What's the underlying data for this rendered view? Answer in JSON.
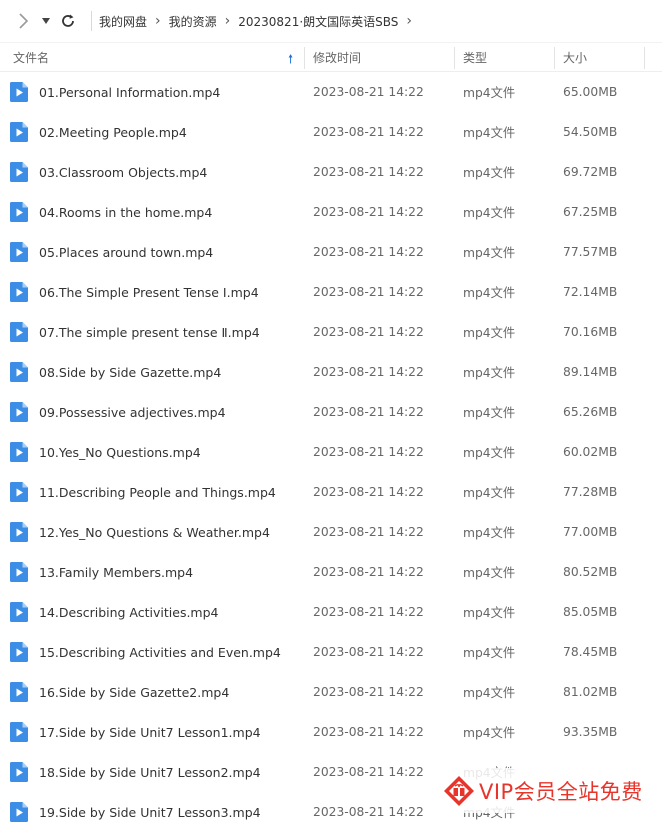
{
  "colors": {
    "accent": "#1e6fd9",
    "file_icon": "#3c8de6",
    "watermark": "#e8352b"
  },
  "toolbar": {
    "forward_icon": "chevron-right-icon",
    "dropdown_icon": "caret-down-icon",
    "refresh_icon": "refresh-icon"
  },
  "breadcrumb": [
    "我的网盘",
    "我的资源",
    "20230821·朗文国际英语SBS"
  ],
  "columns": {
    "name": "文件名",
    "modified": "修改时间",
    "type": "类型",
    "size": "大小",
    "sort_icon": "sort-up-arrow-icon"
  },
  "files": [
    {
      "name": "01.Personal Information.mp4",
      "modified": "2023-08-21 14:22",
      "type": "mp4文件",
      "size": "65.00MB"
    },
    {
      "name": "02.Meeting People.mp4",
      "modified": "2023-08-21 14:22",
      "type": "mp4文件",
      "size": "54.50MB"
    },
    {
      "name": "03.Classroom Objects.mp4",
      "modified": "2023-08-21 14:22",
      "type": "mp4文件",
      "size": "69.72MB"
    },
    {
      "name": "04.Rooms in the home.mp4",
      "modified": "2023-08-21 14:22",
      "type": "mp4文件",
      "size": "67.25MB"
    },
    {
      "name": "05.Places around town.mp4",
      "modified": "2023-08-21 14:22",
      "type": "mp4文件",
      "size": "77.57MB"
    },
    {
      "name": "06.The Simple Present Tense Ⅰ.mp4",
      "modified": "2023-08-21 14:22",
      "type": "mp4文件",
      "size": "72.14MB"
    },
    {
      "name": "07.The simple present tense Ⅱ.mp4",
      "modified": "2023-08-21 14:22",
      "type": "mp4文件",
      "size": "70.16MB"
    },
    {
      "name": "08.Side by Side Gazette.mp4",
      "modified": "2023-08-21 14:22",
      "type": "mp4文件",
      "size": "89.14MB"
    },
    {
      "name": "09.Possessive adjectives.mp4",
      "modified": "2023-08-21 14:22",
      "type": "mp4文件",
      "size": "65.26MB"
    },
    {
      "name": "10.Yes_No Questions.mp4",
      "modified": "2023-08-21 14:22",
      "type": "mp4文件",
      "size": "60.02MB"
    },
    {
      "name": "11.Describing People and Things.mp4",
      "modified": "2023-08-21 14:22",
      "type": "mp4文件",
      "size": "77.28MB"
    },
    {
      "name": "12.Yes_No Questions & Weather.mp4",
      "modified": "2023-08-21 14:22",
      "type": "mp4文件",
      "size": "77.00MB"
    },
    {
      "name": "13.Family Members.mp4",
      "modified": "2023-08-21 14:22",
      "type": "mp4文件",
      "size": "80.52MB"
    },
    {
      "name": "14.Describing Activities.mp4",
      "modified": "2023-08-21 14:22",
      "type": "mp4文件",
      "size": "85.05MB"
    },
    {
      "name": "15.Describing Activities and Even.mp4",
      "modified": "2023-08-21 14:22",
      "type": "mp4文件",
      "size": "78.45MB"
    },
    {
      "name": "16.Side by Side Gazette2.mp4",
      "modified": "2023-08-21 14:22",
      "type": "mp4文件",
      "size": "81.02MB"
    },
    {
      "name": "17.Side by Side Unit7 Lesson1.mp4",
      "modified": "2023-08-21 14:22",
      "type": "mp4文件",
      "size": "93.35MB"
    },
    {
      "name": "18.Side by Side Unit7 Lesson2.mp4",
      "modified": "2023-08-21 14:22",
      "type": "mp4文件",
      "size": ""
    },
    {
      "name": "19.Side by Side Unit7 Lesson3.mp4",
      "modified": "2023-08-21 14:22",
      "type": "mp4文件",
      "size": ""
    }
  ],
  "watermark": {
    "text": "VIP会员全站免费",
    "logo_icon": "gift-box-icon"
  }
}
